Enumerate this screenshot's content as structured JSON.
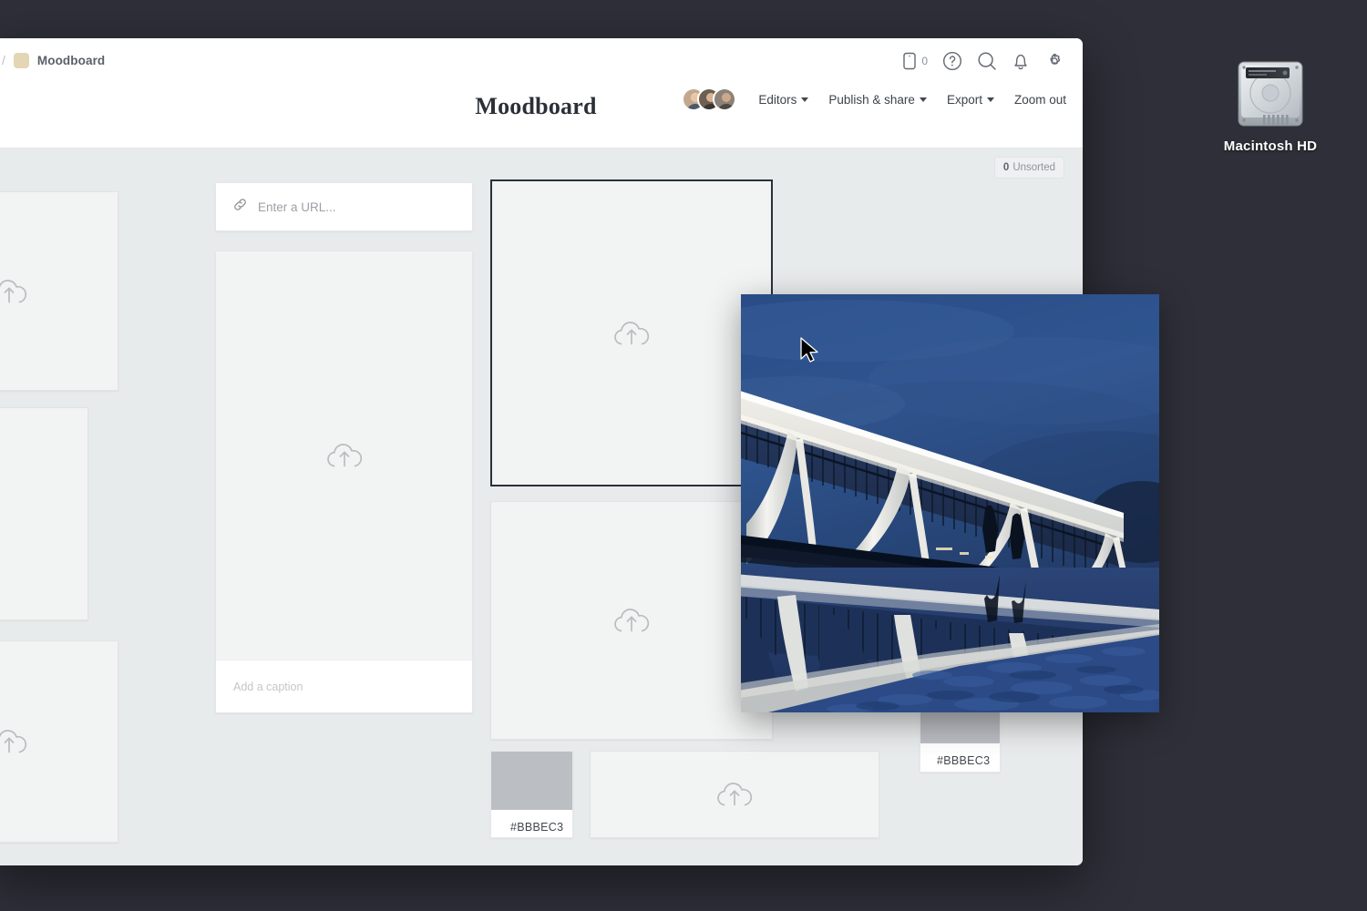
{
  "desktop": {
    "icon_label": "Macintosh HD",
    "icon_name": "hard-drive-icon",
    "background_color": "#2e2f38"
  },
  "app": {
    "breadcrumb": {
      "separator": "/",
      "folder_icon": "folder-chip-icon",
      "label": "Moodboard"
    },
    "title": "Moodboard",
    "icon_strip": [
      {
        "name": "mobile-preview-icon",
        "count": "0"
      },
      {
        "name": "help-icon"
      },
      {
        "name": "search-icon"
      },
      {
        "name": "notifications-bell-icon"
      },
      {
        "name": "settings-gear-icon"
      }
    ],
    "actions": [
      {
        "name": "editors",
        "label": "Editors",
        "caret": true
      },
      {
        "name": "publish-share",
        "label": "Publish & share",
        "caret": true
      },
      {
        "name": "export",
        "label": "Export",
        "caret": true
      },
      {
        "name": "zoom-out",
        "label": "Zoom out",
        "caret": false
      }
    ],
    "avatars_count": 3
  },
  "canvas": {
    "background_color": "#e8ebec",
    "unsorted_badge": {
      "count": "0",
      "label": "Unsorted"
    },
    "url_card": {
      "placeholder": "Enter a URL...",
      "icon": "link-icon"
    },
    "caption_card": {
      "placeholder": "Add a caption",
      "icon": "cloud-upload-icon"
    },
    "placeholder_icon": "cloud-upload-icon",
    "empty_cards": [
      {
        "name": "placeholder-card-left-1"
      },
      {
        "name": "placeholder-card-left-2"
      },
      {
        "name": "placeholder-card-left-3"
      },
      {
        "name": "placeholder-card-center-1"
      },
      {
        "name": "placeholder-card-center-2"
      },
      {
        "name": "placeholder-card-bottom"
      }
    ],
    "drop_target": {
      "name": "active-drop-target",
      "border_color": "#2b3038"
    },
    "swatches": [
      {
        "name": "color-swatch-card-1",
        "hex": "#BBBEC3",
        "color": "#bbbec3"
      },
      {
        "name": "color-swatch-card-2",
        "hex": "#BBBEC3",
        "color": "#bbbec3"
      }
    ]
  },
  "drag": {
    "image_name": "dragged-photo-architecture",
    "description": "Modernist building at blue hour with reflecting pool",
    "cursor": "arrow-cursor"
  }
}
